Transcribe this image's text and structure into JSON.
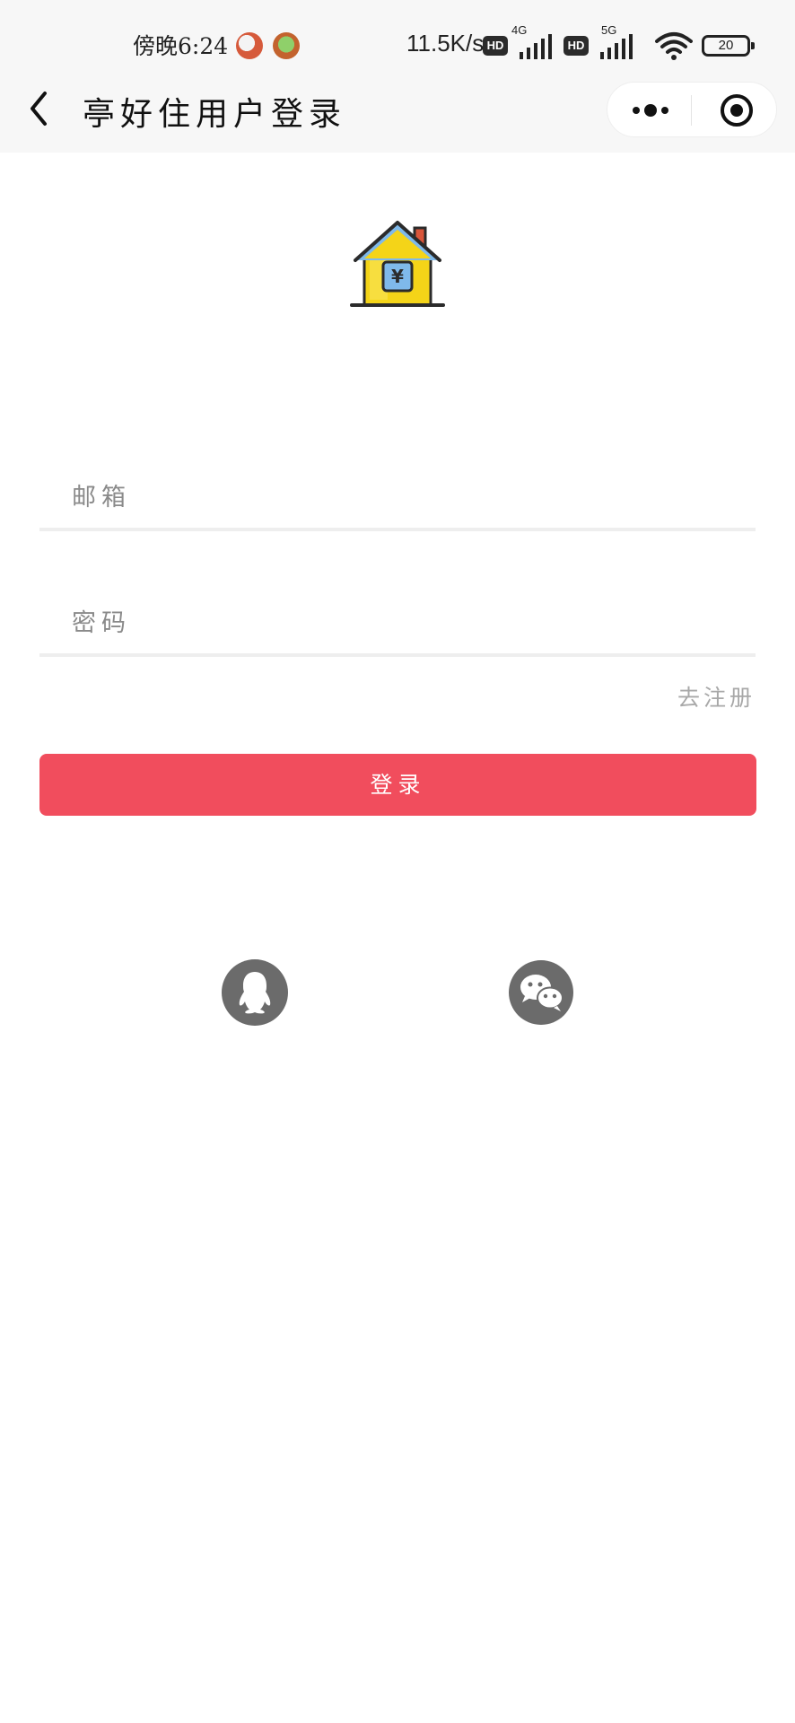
{
  "status_bar": {
    "time": "傍晚6:24",
    "net_speed": "11.5K/s",
    "hd_label": "HD",
    "net_4g": "4G",
    "net_5g": "5G",
    "battery": "20"
  },
  "nav": {
    "title": "亭好住用户登录"
  },
  "form": {
    "email_placeholder": "邮箱",
    "password_placeholder": "密码",
    "register_link": "去注册",
    "login_button": "登录"
  },
  "colors": {
    "primary": "#f14d5d",
    "social_icon_bg": "#6b6b6b",
    "topbar_bg": "#f7f7f7"
  },
  "icons": {
    "logo": "house-yen-icon",
    "social": [
      "qq-icon",
      "wechat-icon"
    ]
  }
}
